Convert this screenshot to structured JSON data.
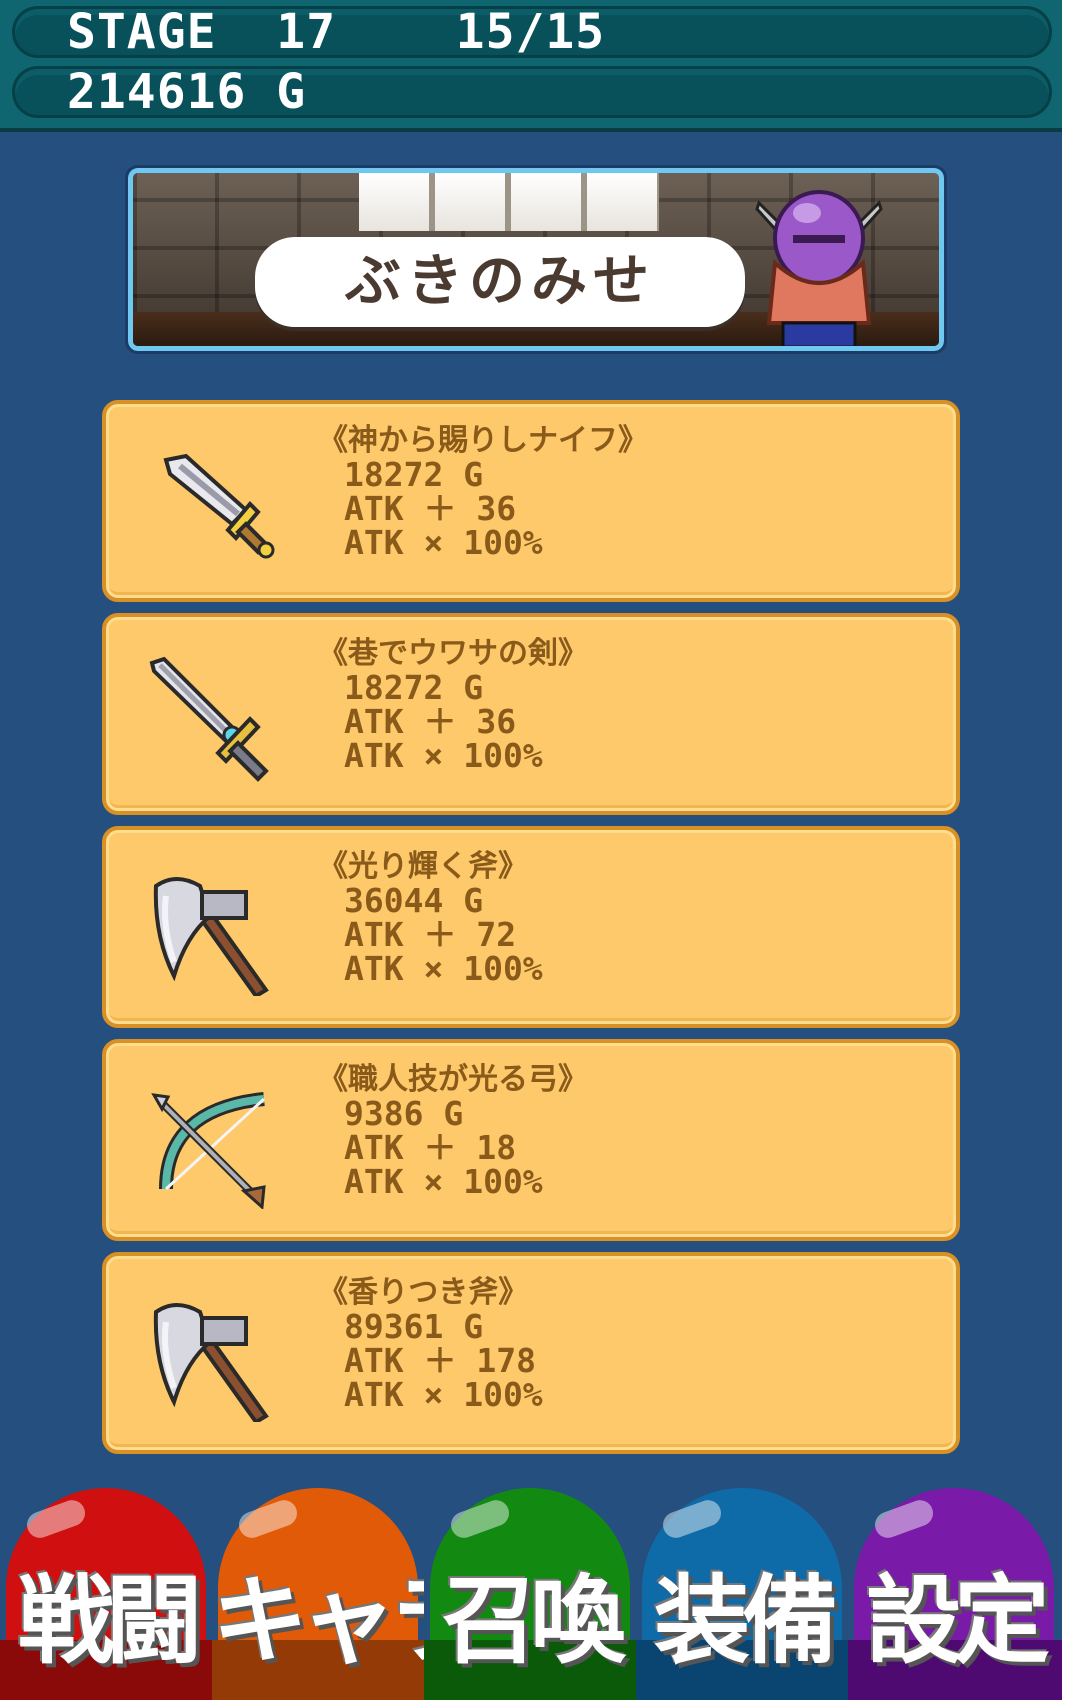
{
  "hud": {
    "stage_text": "STAGE  17    15/15",
    "gold_text": "214616 G"
  },
  "shop": {
    "title": "ぶきのみせ",
    "items": [
      {
        "name": "《神から賜りしナイフ》",
        "price": "18272 G",
        "atk_add": "ATK ＋ 36",
        "atk_mul": "ATK × 100%",
        "icon": "knife-icon"
      },
      {
        "name": "《巷でウワサの剣》",
        "price": "18272 G",
        "atk_add": "ATK ＋ 36",
        "atk_mul": "ATK × 100%",
        "icon": "sword-icon"
      },
      {
        "name": "《光り輝く斧》",
        "price": "36044 G",
        "atk_add": "ATK ＋ 72",
        "atk_mul": "ATK × 100%",
        "icon": "axe-icon"
      },
      {
        "name": "《職人技が光る弓》",
        "price": "9386 G",
        "atk_add": "ATK ＋ 18",
        "atk_mul": "ATK × 100%",
        "icon": "bow-icon"
      },
      {
        "name": "《香りつき斧》",
        "price": "89361 G",
        "atk_add": "ATK ＋ 178",
        "atk_mul": "ATK × 100%",
        "icon": "axe-icon"
      }
    ]
  },
  "nav": {
    "battle": "戦闘",
    "character": "キャラ",
    "summon": "召喚",
    "equip": "装備",
    "settings": "設定"
  },
  "colors": {
    "background": "#244f7e",
    "header": "#106670",
    "card": "#fec96a",
    "card_border": "#d99024",
    "card_text": "#8a5a1a",
    "nav_battle": "#d01010",
    "nav_character": "#e05a08",
    "nav_summon": "#128a12",
    "nav_equip": "#0f6aa8",
    "nav_settings": "#7a1aa8"
  }
}
